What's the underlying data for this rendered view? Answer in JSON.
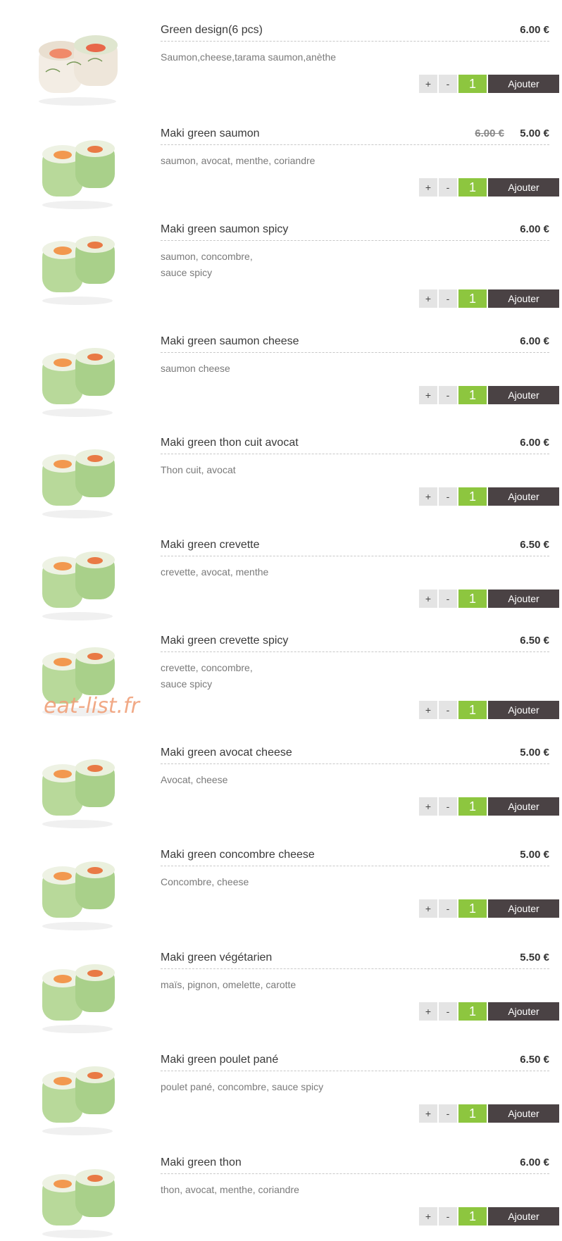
{
  "watermark": "eat-list.fr",
  "colors": {
    "quantity_green": "#8dc63f",
    "add_button": "#4a4244",
    "divider": "#c8c8c8"
  },
  "items": [
    {
      "name": "Green design(6 pcs)",
      "price": "6.00 €",
      "old_price": "",
      "desc_lines": [
        "Saumon,cheese,tarama saumon,anèthe"
      ],
      "qty": "1",
      "plus": "+",
      "minus": "-",
      "add_label": "Ajouter",
      "image": "sushi-roll-green-design-icon"
    },
    {
      "name": "Maki green saumon",
      "price": "5.00 €",
      "old_price": "6.00 €",
      "desc_lines": [
        "saumon, avocat, menthe, coriandre"
      ],
      "qty": "1",
      "plus": "+",
      "minus": "-",
      "add_label": "Ajouter",
      "image": "sushi-roll-green-icon"
    },
    {
      "name": "Maki green saumon spicy",
      "price": "6.00 €",
      "old_price": "",
      "desc_lines": [
        "saumon, concombre,",
        "sauce spicy"
      ],
      "qty": "1",
      "plus": "+",
      "minus": "-",
      "add_label": "Ajouter",
      "image": "sushi-roll-green-icon"
    },
    {
      "name": "Maki green saumon cheese",
      "price": "6.00 €",
      "old_price": "",
      "desc_lines": [
        "saumon cheese"
      ],
      "qty": "1",
      "plus": "+",
      "minus": "-",
      "add_label": "Ajouter",
      "image": "sushi-roll-green-icon"
    },
    {
      "name": "Maki green thon cuit avocat",
      "price": "6.00 €",
      "old_price": "",
      "desc_lines": [
        "Thon cuit, avocat"
      ],
      "qty": "1",
      "plus": "+",
      "minus": "-",
      "add_label": "Ajouter",
      "image": "sushi-roll-green-icon"
    },
    {
      "name": "Maki green crevette",
      "price": "6.50 €",
      "old_price": "",
      "desc_lines": [
        "crevette, avocat, menthe"
      ],
      "qty": "1",
      "plus": "+",
      "minus": "-",
      "add_label": "Ajouter",
      "image": "sushi-roll-green-icon"
    },
    {
      "name": "Maki green crevette spicy",
      "price": "6.50 €",
      "old_price": "",
      "desc_lines": [
        "crevette, concombre,",
        "sauce spicy"
      ],
      "qty": "1",
      "plus": "+",
      "minus": "-",
      "add_label": "Ajouter",
      "image": "sushi-roll-green-icon"
    },
    {
      "name": "Maki green avocat cheese",
      "price": "5.00 €",
      "old_price": "",
      "desc_lines": [
        "Avocat, cheese"
      ],
      "qty": "1",
      "plus": "+",
      "minus": "-",
      "add_label": "Ajouter",
      "image": "sushi-roll-green-icon"
    },
    {
      "name": "Maki green concombre cheese",
      "price": "5.00 €",
      "old_price": "",
      "desc_lines": [
        "Concombre, cheese"
      ],
      "qty": "1",
      "plus": "+",
      "minus": "-",
      "add_label": "Ajouter",
      "image": "sushi-roll-green-icon"
    },
    {
      "name": "Maki green végétarien",
      "price": "5.50 €",
      "old_price": "",
      "desc_lines": [
        "maïs, pignon, omelette, carotte"
      ],
      "qty": "1",
      "plus": "+",
      "minus": "-",
      "add_label": "Ajouter",
      "image": "sushi-roll-green-icon"
    },
    {
      "name": "Maki green poulet pané",
      "price": "6.50 €",
      "old_price": "",
      "desc_lines": [
        "poulet pané, concombre, sauce spicy"
      ],
      "qty": "1",
      "plus": "+",
      "minus": "-",
      "add_label": "Ajouter",
      "image": "sushi-roll-green-icon"
    },
    {
      "name": "Maki green thon",
      "price": "6.00 €",
      "old_price": "",
      "desc_lines": [
        "thon, avocat, menthe, coriandre"
      ],
      "qty": "1",
      "plus": "+",
      "minus": "-",
      "add_label": "Ajouter",
      "image": "sushi-roll-green-icon"
    }
  ]
}
